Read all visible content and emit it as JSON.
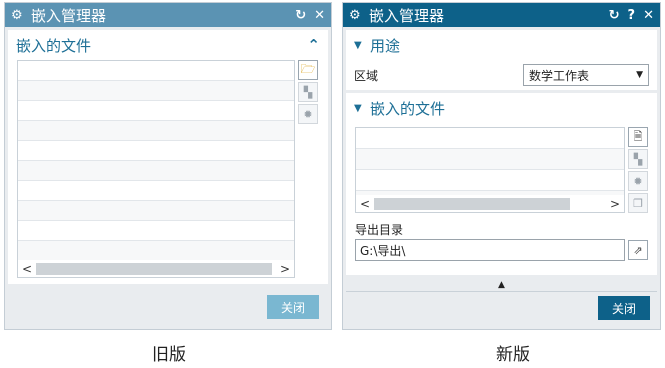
{
  "old": {
    "title": "嵌入管理器",
    "section_label": "嵌入的文件",
    "close_label": "关闭",
    "caption": "旧版",
    "row_count": 10,
    "scroll_left": "<",
    "scroll_right": ">"
  },
  "new": {
    "title": "嵌入管理器",
    "help_label": "?",
    "usage_label": "用途",
    "area_label": "区域",
    "area_value": "数学工作表",
    "section_label": "嵌入的文件",
    "export_dir_label": "导出目录",
    "export_dir_value": "G:\\导出\\",
    "close_label": "关闭",
    "caption": "新版",
    "row_count": 4,
    "scroll_left": "<",
    "scroll_right": ">"
  },
  "icons": [
    "gear-icon",
    "reset-icon",
    "help-icon",
    "close-icon",
    "chevron-up-icon",
    "add-folder-icon",
    "replace-icon",
    "settings-icon",
    "copy-icon",
    "export-folder-icon",
    "dropdown-icon",
    "collapse-triangle-icon"
  ],
  "colors": {
    "old_titlebar": "#5b93b3",
    "new_titlebar": "#0d6189",
    "section_text": "#1d6f96",
    "old_button": "#7ab7d1",
    "new_button": "#0d6189"
  }
}
